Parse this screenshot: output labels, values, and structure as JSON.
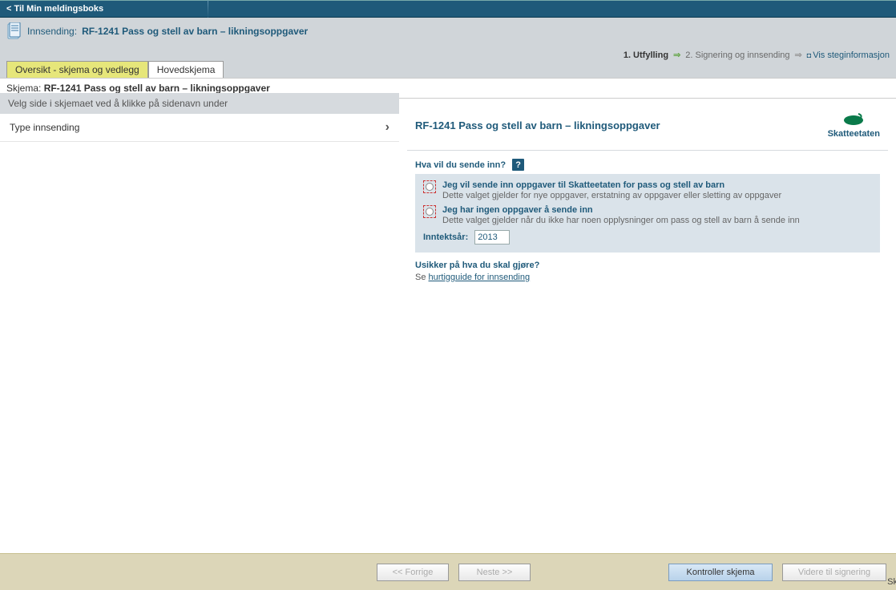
{
  "topbar": {
    "back_link": "< Til Min meldingsboks"
  },
  "header": {
    "submission_label": "Innsending:",
    "submission_title": "RF-1241 Pass og stell av barn – likningsoppgaver"
  },
  "steps": {
    "step1": "1.  Utfylling",
    "step2": "2.  Signering og innsending",
    "show_info": "Vis steginformasjon"
  },
  "tabs": {
    "overview": "Oversikt - skjema og vedlegg",
    "main": "Hovedskjema"
  },
  "schema_line": {
    "label": "Skjema: ",
    "value": "RF-1241 Pass og stell av barn – likningsoppgaver"
  },
  "left": {
    "header": "Velg side i skjemaet ved å klikke på sidenavn under",
    "items": [
      {
        "label": "Type innsending"
      }
    ]
  },
  "form": {
    "title": "RF-1241 Pass og stell av barn – likningsoppgaver",
    "agency": "Skatteetaten",
    "question": "Hva vil du sende inn?",
    "options": [
      {
        "label": "Jeg vil sende inn oppgaver til Skatteetaten for pass og stell av barn",
        "desc": "Dette valget gjelder for nye oppgaver, erstatning av oppgaver eller sletting av oppgaver"
      },
      {
        "label": "Jeg har ingen oppgaver å sende inn",
        "desc": "Dette valget gjelder når du ikke har noen opplysninger om pass og stell av barn å sende inn"
      }
    ],
    "year_label": "Inntektsår:",
    "year_value": "2013",
    "unsure": "Usikker på hva du skal gjøre?",
    "see_prefix": "Se ",
    "see_link": "hurtigguide for innsending"
  },
  "footer": {
    "prev": "<< Forrige",
    "next": "Neste >>",
    "check": "Kontroller skjema",
    "sign": "Videre til signering"
  }
}
